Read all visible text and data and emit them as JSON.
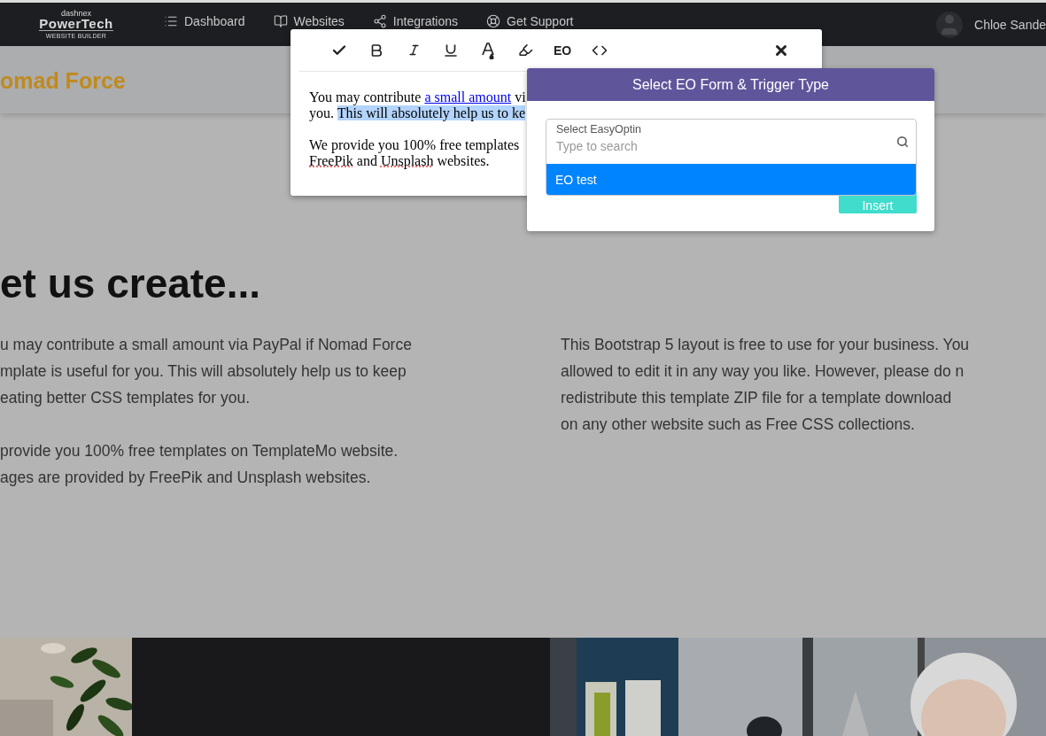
{
  "nav": {
    "logo": {
      "top": "dashnex",
      "main": "PowerTech",
      "sub": "WEBSITE BUILDER"
    },
    "items": [
      {
        "label": "Dashboard"
      },
      {
        "label": "Websites"
      },
      {
        "label": "Integrations"
      },
      {
        "label": "Get Support"
      }
    ],
    "user": "Chloe Sande"
  },
  "page": {
    "brand": "omad Force",
    "heading": "et us create...",
    "left_paragraphs": [
      [
        "u may contribute a small amount via PayPal if Nomad Force",
        "mplate is useful for you. This will absolutely help us to keep",
        "eating better CSS templates for you."
      ],
      [
        "provide you 100% free templates on TemplateMo website.",
        "ages are provided by FreePik and Unsplash websites."
      ]
    ],
    "right_paragraphs": [
      [
        "This Bootstrap 5 layout is free to use for your business. You",
        "allowed to edit it in any way you like. However, please do n",
        "redistribute this template ZIP file for a template download",
        "on any other website such as Free CSS collections."
      ]
    ]
  },
  "editor": {
    "tools": [
      {
        "kind": "icon"
      },
      {
        "kind": "icon"
      },
      {
        "kind": "icon"
      },
      {
        "kind": "icon"
      },
      {
        "kind": "icon"
      },
      {
        "kind": "icon"
      },
      {
        "kind": "text",
        "label": "EO"
      },
      {
        "kind": "icon"
      }
    ],
    "paragraphs": [
      [
        [
          {
            "kind": "plain",
            "text": "You may contribute "
          },
          {
            "kind": "link",
            "text": "a small amount"
          },
          {
            "kind": "plain",
            "text": " vi"
          }
        ],
        [
          {
            "kind": "plain",
            "text": "you. "
          },
          {
            "kind": "selected",
            "text": "This will absolutely help us to ke"
          }
        ]
      ],
      [
        [
          {
            "kind": "plain",
            "text": "We provide you 100% free templates"
          }
        ],
        [
          {
            "kind": "misspelled",
            "text": "FreePik"
          },
          {
            "kind": "plain",
            "text": " and "
          },
          {
            "kind": "misspelled",
            "text": "Unsplash"
          },
          {
            "kind": "plain",
            "text": " websites."
          }
        ]
      ]
    ]
  },
  "modal": {
    "title": "Select EO Form & Trigger Type",
    "field_label": "Select EasyOptin",
    "placeholder": "Type to search",
    "options": [
      {
        "label": "EO test",
        "selected": true
      }
    ],
    "button": "Insert"
  }
}
